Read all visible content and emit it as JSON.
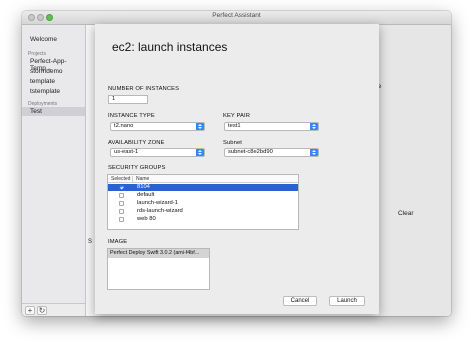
{
  "window": {
    "title": "Perfect Assistant"
  },
  "sidebar": {
    "welcome": "Welcome",
    "projects_header": "Projects",
    "projects": [
      "Perfect-App-Temp...",
      "stormdemo",
      "template",
      "tstemplate"
    ],
    "deployments_header": "Deployments",
    "deployments": [
      "Test"
    ],
    "add_label": "+",
    "refresh_label": "↻"
  },
  "background": {
    "frag_partial_text": "e",
    "frag_left_letter": "S",
    "clear_label": "Clear"
  },
  "sheet": {
    "title": "ec2: launch instances",
    "num_instances_label": "NUMBER OF INSTANCES",
    "num_instances_value": "1",
    "instance_type_label": "INSTANCE TYPE",
    "instance_type_value": "t2.nano",
    "key_pair_label": "KEY PAIR",
    "key_pair_value": "test1",
    "availability_zone_label": "AVAILABILITY ZONE",
    "availability_zone_value": "us-east-1",
    "subnet_label": "Subnet",
    "subnet_value": "subnet-c8e2bd90",
    "security_groups_label": "SECURITY GROUPS",
    "sg_col_selected": "Selected",
    "sg_col_name": "Name",
    "security_groups": [
      {
        "name": "8104",
        "checked": true,
        "selected": true
      },
      {
        "name": "default",
        "checked": false,
        "selected": false
      },
      {
        "name": "launch-wizard-1",
        "checked": false,
        "selected": false
      },
      {
        "name": "rds-launch-wizard",
        "checked": false,
        "selected": false
      },
      {
        "name": "web 80",
        "checked": false,
        "selected": false
      }
    ],
    "image_label": "IMAGE",
    "image_value": "Perfect Deploy Swift 3.0.2 (ami-f4bf...",
    "cancel_label": "Cancel",
    "launch_label": "Launch"
  },
  "colors": {
    "accent": "#3b86f7",
    "selection": "#2a62d6"
  }
}
